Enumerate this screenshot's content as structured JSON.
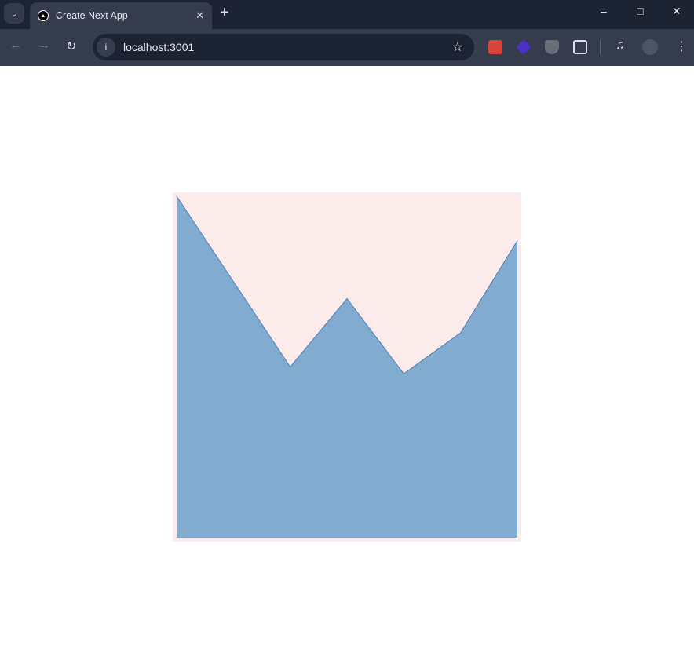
{
  "browser": {
    "tab_title": "Create Next App",
    "url": "localhost:3001"
  },
  "chart_data": {
    "type": "area",
    "title": "",
    "xlabel": "",
    "ylabel": "",
    "x": [
      0,
      2,
      3,
      4,
      5,
      6
    ],
    "y": [
      100,
      50,
      70,
      48,
      60,
      87
    ],
    "xlim": [
      0,
      6
    ],
    "ylim": [
      0,
      100
    ],
    "grid": false,
    "colors": {
      "background": "#fcebeb",
      "fill": "#81abcf",
      "stroke": "#4a7fb5"
    }
  }
}
